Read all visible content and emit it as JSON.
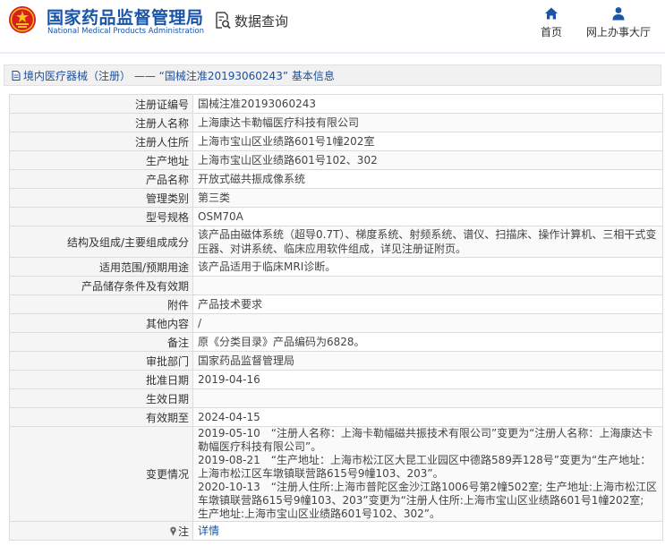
{
  "header": {
    "org_name_cn": "国家药品监督管理局",
    "org_name_en": "National Medical Products Administration",
    "query_label": "数据查询",
    "nav": [
      {
        "label": "首页",
        "icon": "home-icon"
      },
      {
        "label": "网上办事大厅",
        "icon": "user-icon"
      }
    ]
  },
  "breadcrumb": {
    "text": "境内医疗器械（注册） —— “国械注准20193060243” 基本信息"
  },
  "colors": {
    "brand_blue": "#1a55a7",
    "emblem_red": "#d7201d",
    "emblem_gold": "#f5c518"
  },
  "fields": {
    "reg_no": {
      "label": "注册证编号",
      "value": "国械注准20193060243"
    },
    "registrant": {
      "label": "注册人名称",
      "value": "上海康达卡勒幅医疗科技有限公司"
    },
    "registrant_addr": {
      "label": "注册人住所",
      "value": "上海市宝山区业绩路601号1幢202室"
    },
    "production_addr": {
      "label": "生产地址",
      "value": "上海市宝山区业绩路601号102、302"
    },
    "product_name": {
      "label": "产品名称",
      "value": "开放式磁共振成像系统"
    },
    "category": {
      "label": "管理类别",
      "value": "第三类"
    },
    "model": {
      "label": "型号规格",
      "value": "OSM70A"
    },
    "structure": {
      "label": "结构及组成/主要组成成分",
      "value": "该产品由磁体系统（超导0.7T）、梯度系统、射频系统、谱仪、扫描床、操作计算机、三相干式变压器、对讲系统、临床应用软件组成，详见注册证附页。"
    },
    "scope": {
      "label": "适用范围/预期用途",
      "value": "该产品适用于临床MRI诊断。"
    },
    "storage": {
      "label": "产品储存条件及有效期",
      "value": ""
    },
    "attachment": {
      "label": "附件",
      "value": "产品技术要求"
    },
    "other": {
      "label": "其他内容",
      "value": "/"
    },
    "remark": {
      "label": "备注",
      "value": "原《分类目录》产品编码为6828。"
    },
    "approval_dept": {
      "label": "审批部门",
      "value": "国家药品监督管理局"
    },
    "approval_date": {
      "label": "批准日期",
      "value": "2019-04-16"
    },
    "effective_date": {
      "label": "生效日期",
      "value": ""
    },
    "valid_until": {
      "label": "有效期至",
      "value": "2024-04-15"
    },
    "changes": {
      "label": "变更情况",
      "lines": [
        "2019-05-10　“注册人名称：上海卡勒幅磁共振技术有限公司”变更为“注册人名称：上海康达卡勒幅医疗科技有限公司”。",
        "2019-08-21　“生产地址：上海市松江区大昆工业园区中德路589弄128号”变更为“生产地址：上海市松江区车墩镇联营路615号9幢103、203”。",
        "2020-10-13　“注册人住所:上海市普陀区金沙江路1006号第2幢502室; 生产地址:上海市松江区车墩镇联营路615号9幢103、203”变更为“注册人住所:上海市宝山区业绩路601号1幢202室; 生产地址:上海市宝山区业绩路601号102、302”。"
      ]
    },
    "note": {
      "label": "注",
      "value": "详情",
      "icon": "pin-icon"
    }
  }
}
